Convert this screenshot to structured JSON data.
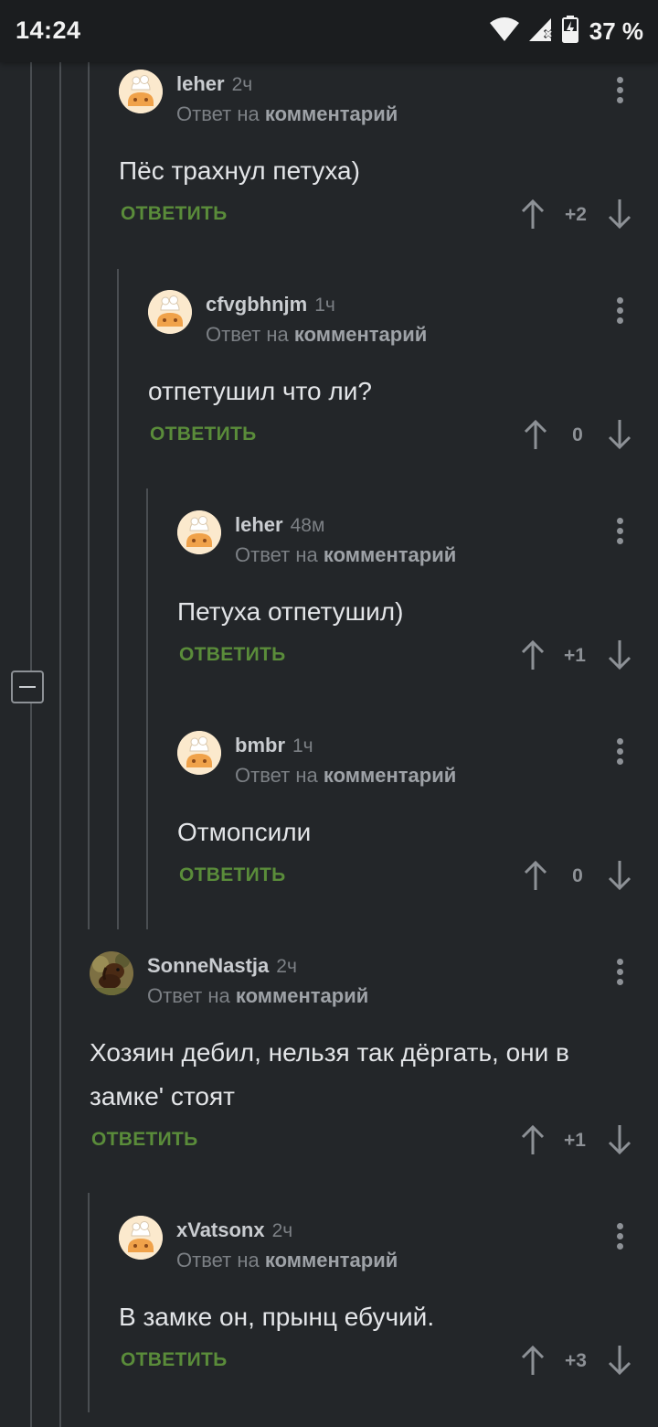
{
  "status_bar": {
    "time": "14:24",
    "battery": "37 %",
    "icons": [
      "wifi-icon",
      "signal-icon",
      "battery-icon"
    ]
  },
  "common": {
    "reply_prefix": "Ответ на",
    "reply_target": "комментарий",
    "reply_button": "ОТВЕТИТЬ"
  },
  "comments": [
    {
      "author": "leher",
      "time": "2ч",
      "text": "Пёс трахнул петуха)",
      "score": "+2"
    },
    {
      "author": "cfvgbhnjm",
      "time": "1ч",
      "text": "отпетушил что ли?",
      "score": "0"
    },
    {
      "author": "leher",
      "time": "48м",
      "text": "Петуха отпетушил)",
      "score": "+1"
    },
    {
      "author": "bmbr",
      "time": "1ч",
      "text": "Отмопсили",
      "score": "0"
    },
    {
      "author": "SonneNastja",
      "time": "2ч",
      "text": "Хозяин дебил, нельзя так дёргать, они в замке' стоят",
      "score": "+1"
    },
    {
      "author": "xVatsonx",
      "time": "2ч",
      "text": "В замке он, прынц ебучий.",
      "score": "+3"
    }
  ],
  "colors": {
    "background": "#232629",
    "reply_button": "#5a8c3a",
    "thread_line": "#4a4e52"
  }
}
